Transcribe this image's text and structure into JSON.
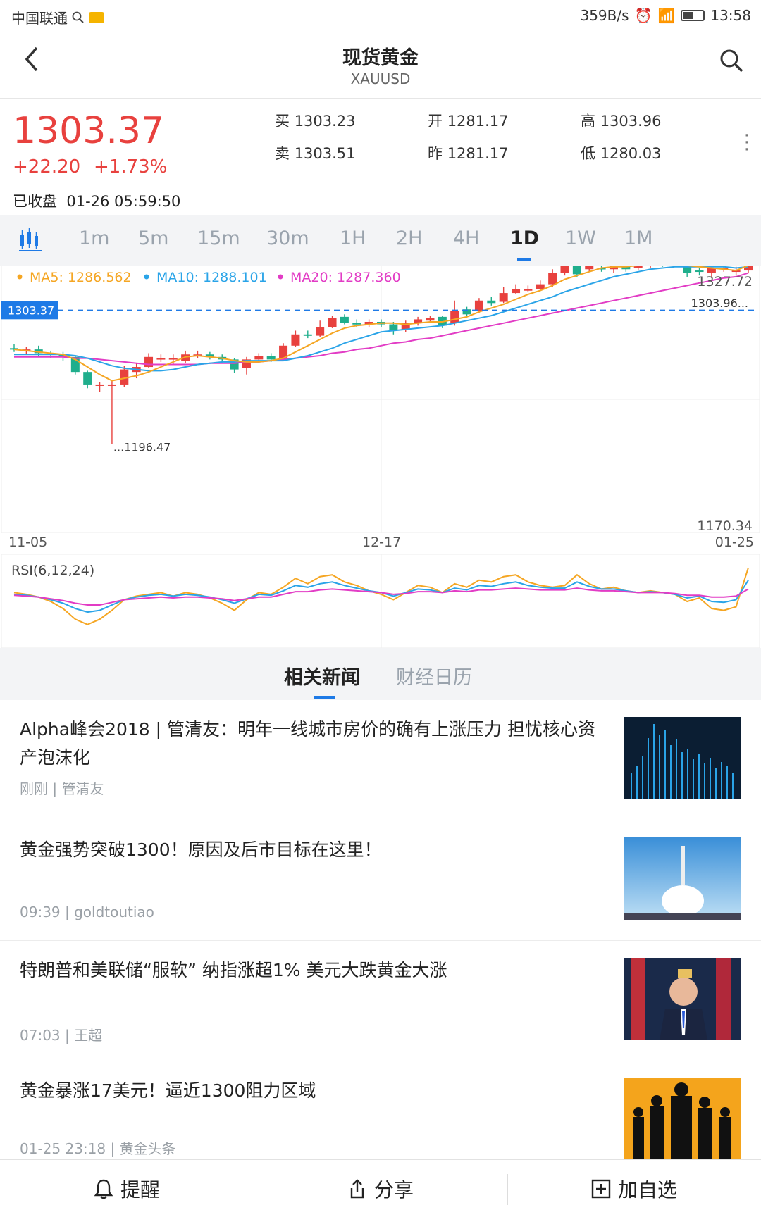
{
  "status_bar": {
    "carrier": "中国联通",
    "speed": "359B/s",
    "time": "13:58"
  },
  "header": {
    "title": "现货黄金",
    "symbol": "XAUUSD"
  },
  "quote": {
    "price": "1303.37",
    "change": "+22.20",
    "change_pct": "+1.73%",
    "buy_label": "买",
    "buy": "1303.23",
    "sell_label": "卖",
    "sell": "1303.51",
    "open_label": "开",
    "open": "1281.17",
    "prev_label": "昨",
    "prev": "1281.17",
    "high_label": "高",
    "high": "1303.96",
    "low_label": "低",
    "low": "1280.03",
    "status": "已收盘",
    "timestamp": "01-26 05:59:50"
  },
  "timeframes": [
    "1m",
    "5m",
    "15m",
    "30m",
    "1H",
    "2H",
    "4H",
    "1D",
    "1W",
    "1M"
  ],
  "active_timeframe": "1D",
  "colors": {
    "up": "#e8413e",
    "down": "#1fae8c",
    "ma5": "#f5a623",
    "ma10": "#2aa4e8",
    "ma20": "#e23cc5",
    "accent": "#1e7ae6"
  },
  "chart_data": [
    {
      "type": "candlestick",
      "legend": [
        {
          "label": "MA5: 1286.562"
        },
        {
          "label": "MA10: 1288.101"
        },
        {
          "label": "MA20: 1287.360"
        }
      ],
      "ylim": [
        1170.34,
        1327.72
      ],
      "y_top_label": "1327.72",
      "y_bottom_label": "1170.34",
      "current_price_label": "1303.37",
      "current_price": 1303.37,
      "max_label": "1303.96...",
      "min_label": "...1196.47",
      "x_labels": [
        "11-05",
        "12-17",
        "01-25"
      ],
      "candles": [
        {
          "o": 1273,
          "c": 1272,
          "h": 1276,
          "l": 1270
        },
        {
          "o": 1271,
          "c": 1272,
          "h": 1274,
          "l": 1268
        },
        {
          "o": 1272,
          "c": 1269,
          "h": 1275,
          "l": 1267
        },
        {
          "o": 1269,
          "c": 1268,
          "h": 1271,
          "l": 1265
        },
        {
          "o": 1268,
          "c": 1266,
          "h": 1270,
          "l": 1263
        },
        {
          "o": 1266,
          "c": 1254,
          "h": 1267,
          "l": 1252
        },
        {
          "o": 1254,
          "c": 1244,
          "h": 1255,
          "l": 1241
        },
        {
          "o": 1243,
          "c": 1244,
          "h": 1246,
          "l": 1238
        },
        {
          "o": 1244,
          "c": 1244,
          "h": 1247,
          "l": 1196.47
        },
        {
          "o": 1244,
          "c": 1256,
          "h": 1259,
          "l": 1242
        },
        {
          "o": 1254,
          "c": 1258,
          "h": 1261,
          "l": 1249
        },
        {
          "o": 1258,
          "c": 1266,
          "h": 1269,
          "l": 1257
        },
        {
          "o": 1265,
          "c": 1265,
          "h": 1268,
          "l": 1262
        },
        {
          "o": 1264,
          "c": 1265,
          "h": 1268,
          "l": 1260
        },
        {
          "o": 1263,
          "c": 1268,
          "h": 1271,
          "l": 1261
        },
        {
          "o": 1268,
          "c": 1268,
          "h": 1271,
          "l": 1265
        },
        {
          "o": 1268,
          "c": 1266,
          "h": 1270,
          "l": 1264
        },
        {
          "o": 1266,
          "c": 1264,
          "h": 1268,
          "l": 1261
        },
        {
          "o": 1264,
          "c": 1256,
          "h": 1265,
          "l": 1253
        },
        {
          "o": 1257,
          "c": 1264,
          "h": 1266,
          "l": 1252
        },
        {
          "o": 1264,
          "c": 1267,
          "h": 1269,
          "l": 1262
        },
        {
          "o": 1267,
          "c": 1264,
          "h": 1269,
          "l": 1262
        },
        {
          "o": 1264,
          "c": 1275,
          "h": 1277,
          "l": 1263
        },
        {
          "o": 1275,
          "c": 1284,
          "h": 1287,
          "l": 1274
        },
        {
          "o": 1284,
          "c": 1283,
          "h": 1287,
          "l": 1281
        },
        {
          "o": 1283,
          "c": 1290,
          "h": 1295,
          "l": 1282
        },
        {
          "o": 1290,
          "c": 1297,
          "h": 1299,
          "l": 1289
        },
        {
          "o": 1298,
          "c": 1293,
          "h": 1300,
          "l": 1292
        },
        {
          "o": 1293,
          "c": 1292,
          "h": 1296,
          "l": 1290
        },
        {
          "o": 1292,
          "c": 1294,
          "h": 1296,
          "l": 1290
        },
        {
          "o": 1294,
          "c": 1292,
          "h": 1296,
          "l": 1290
        },
        {
          "o": 1292,
          "c": 1287,
          "h": 1294,
          "l": 1284
        },
        {
          "o": 1288,
          "c": 1293,
          "h": 1295,
          "l": 1286
        },
        {
          "o": 1293,
          "c": 1296,
          "h": 1298,
          "l": 1291
        },
        {
          "o": 1295,
          "c": 1297,
          "h": 1299,
          "l": 1293
        },
        {
          "o": 1298,
          "c": 1291,
          "h": 1299,
          "l": 1289
        },
        {
          "o": 1293,
          "c": 1303,
          "h": 1311,
          "l": 1291
        },
        {
          "o": 1304,
          "c": 1300,
          "h": 1306,
          "l": 1298
        },
        {
          "o": 1303,
          "c": 1311,
          "h": 1313,
          "l": 1301
        },
        {
          "o": 1311,
          "c": 1309,
          "h": 1314,
          "l": 1307
        },
        {
          "o": 1310,
          "c": 1317,
          "h": 1322,
          "l": 1309
        },
        {
          "o": 1317,
          "c": 1320,
          "h": 1324,
          "l": 1316
        },
        {
          "o": 1320,
          "c": 1320,
          "h": 1323,
          "l": 1318
        },
        {
          "o": 1320,
          "c": 1324,
          "h": 1327,
          "l": 1319
        },
        {
          "o": 1324,
          "c": 1333,
          "h": 1336,
          "l": 1322
        },
        {
          "o": 1333,
          "c": 1342,
          "h": 1346,
          "l": 1331
        },
        {
          "o": 1341,
          "c": 1332,
          "h": 1344,
          "l": 1330
        },
        {
          "o": 1336,
          "c": 1341,
          "h": 1343,
          "l": 1334
        },
        {
          "o": 1337,
          "c": 1336,
          "h": 1340,
          "l": 1334
        },
        {
          "o": 1336,
          "c": 1341,
          "h": 1343,
          "l": 1333
        },
        {
          "o": 1342,
          "c": 1336,
          "h": 1344,
          "l": 1334
        },
        {
          "o": 1337,
          "c": 1340,
          "h": 1342,
          "l": 1335
        },
        {
          "o": 1340,
          "c": 1341,
          "h": 1343,
          "l": 1337
        },
        {
          "o": 1341,
          "c": 1340,
          "h": 1343,
          "l": 1338
        },
        {
          "o": 1341,
          "c": 1342,
          "h": 1344,
          "l": 1339
        },
        {
          "o": 1342,
          "c": 1333,
          "h": 1344,
          "l": 1330
        },
        {
          "o": 1335,
          "c": 1334,
          "h": 1337,
          "l": 1331
        },
        {
          "o": 1333,
          "c": 1337,
          "h": 1339,
          "l": 1330
        },
        {
          "o": 1336,
          "c": 1337,
          "h": 1339,
          "l": 1334
        },
        {
          "o": 1335,
          "c": 1335,
          "h": 1338,
          "l": 1331
        },
        {
          "o": 1335,
          "c": 1348,
          "h": 1350,
          "l": 1333
        }
      ],
      "ma5": [
        1272,
        1271,
        1270,
        1269,
        1268,
        1264,
        1258,
        1252,
        1247,
        1249,
        1251,
        1254,
        1258,
        1262,
        1266,
        1267,
        1266,
        1265,
        1263,
        1262,
        1262,
        1263,
        1265,
        1270,
        1275,
        1280,
        1285,
        1289,
        1291,
        1292,
        1293,
        1293,
        1292,
        1293,
        1294,
        1294,
        1296,
        1298,
        1302,
        1305,
        1308,
        1312,
        1316,
        1319,
        1323,
        1328,
        1331,
        1334,
        1337,
        1338,
        1338,
        1339,
        1339,
        1340,
        1340,
        1339,
        1338,
        1337,
        1336,
        1335,
        1339
      ],
      "ma10": [
        1268,
        1268,
        1268,
        1268,
        1268,
        1267,
        1265,
        1262,
        1259,
        1257,
        1256,
        1255,
        1255,
        1256,
        1258,
        1260,
        1261,
        1262,
        1262,
        1263,
        1263,
        1263,
        1263,
        1265,
        1267,
        1270,
        1273,
        1277,
        1280,
        1283,
        1286,
        1287,
        1288,
        1289,
        1290,
        1291,
        1293,
        1295,
        1297,
        1299,
        1302,
        1305,
        1308,
        1311,
        1314,
        1318,
        1321,
        1324,
        1327,
        1330,
        1332,
        1334,
        1336,
        1337,
        1338,
        1338,
        1338,
        1338,
        1338,
        1337,
        1338
      ],
      "ma20": [
        1266,
        1266,
        1266,
        1266,
        1266,
        1265,
        1265,
        1264,
        1263,
        1262,
        1261,
        1260,
        1260,
        1260,
        1260,
        1260,
        1261,
        1261,
        1261,
        1262,
        1262,
        1263,
        1264,
        1265,
        1266,
        1267,
        1269,
        1270,
        1272,
        1273,
        1275,
        1277,
        1278,
        1280,
        1281,
        1283,
        1285,
        1287,
        1289,
        1291,
        1293,
        1295,
        1297,
        1299,
        1301,
        1303,
        1305,
        1307,
        1309,
        1311,
        1313,
        1315,
        1317,
        1319,
        1321,
        1323,
        1325,
        1327,
        1329,
        1330,
        1333
      ]
    },
    {
      "type": "line",
      "title": "RSI(6,12,24)",
      "ylim": [
        0,
        100
      ],
      "series": [
        {
          "name": "RSI6",
          "values": [
            60,
            58,
            55,
            50,
            42,
            30,
            24,
            30,
            40,
            52,
            56,
            58,
            60,
            56,
            60,
            58,
            54,
            48,
            40,
            52,
            60,
            58,
            66,
            76,
            70,
            78,
            80,
            72,
            68,
            62,
            58,
            52,
            60,
            68,
            66,
            60,
            70,
            66,
            74,
            72,
            78,
            80,
            72,
            68,
            66,
            68,
            80,
            70,
            64,
            66,
            62,
            60,
            62,
            60,
            58,
            50,
            54,
            42,
            40,
            44,
            88
          ]
        },
        {
          "name": "RSI12",
          "values": [
            58,
            57,
            55,
            52,
            48,
            42,
            38,
            40,
            46,
            52,
            55,
            57,
            58,
            56,
            58,
            57,
            55,
            52,
            48,
            53,
            58,
            57,
            62,
            68,
            66,
            70,
            72,
            68,
            65,
            62,
            60,
            56,
            60,
            64,
            63,
            60,
            65,
            63,
            68,
            67,
            70,
            72,
            68,
            66,
            65,
            65,
            72,
            67,
            64,
            64,
            62,
            60,
            61,
            60,
            58,
            54,
            56,
            50,
            49,
            52,
            74
          ]
        },
        {
          "name": "RSI24",
          "values": [
            57,
            56,
            55,
            53,
            51,
            48,
            46,
            46,
            49,
            52,
            53,
            54,
            55,
            54,
            55,
            55,
            54,
            53,
            51,
            53,
            55,
            55,
            58,
            61,
            61,
            63,
            64,
            63,
            62,
            61,
            60,
            58,
            59,
            61,
            61,
            60,
            62,
            61,
            63,
            63,
            64,
            65,
            64,
            63,
            63,
            63,
            65,
            63,
            62,
            62,
            61,
            60,
            60,
            60,
            59,
            57,
            57,
            55,
            55,
            56,
            64
          ]
        }
      ]
    }
  ],
  "news_tabs": [
    "相关新闻",
    "财经日历"
  ],
  "news": [
    {
      "title": "Alpha峰会2018 | 管清友：明年一线城市房价的确有上涨压力 担忧核心资产泡沫化",
      "time": "刚刚",
      "source": "管清友"
    },
    {
      "title": "黄金强势突破1300！原因及后市目标在这里！",
      "time": "09:39",
      "source": "goldtoutiao"
    },
    {
      "title": "特朗普和美联储“服软” 纳指涨超1% 美元大跌黄金大涨",
      "time": "07:03",
      "source": "王超"
    },
    {
      "title": "黄金暴涨17美元！逼近1300阻力区域",
      "time": "01-25 23:18",
      "source": "黄金头条"
    }
  ],
  "bottom_bar": {
    "alert": "提醒",
    "share": "分享",
    "watch": "加自选"
  }
}
